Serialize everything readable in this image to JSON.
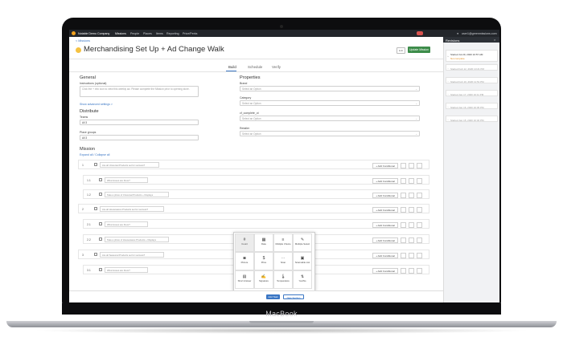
{
  "device": {
    "brand": "MacBook"
  },
  "topbar": {
    "company": "Notable Demo Company",
    "nav": [
      "Missions",
      "People",
      "Places",
      "Items",
      "Reporting",
      "Price/Perks"
    ],
    "user": "user1@greenmissions.com"
  },
  "header": {
    "back_link": "< Missions",
    "title": "Merchandising Set Up + Ad Change Walk",
    "small_button": "Edit",
    "primary_button": "Update Mission"
  },
  "tabs": [
    "Build",
    "Schedule",
    "Verify"
  ],
  "general": {
    "heading": "General",
    "instructions_label": "Instructions (optional)",
    "instructions_value": "Click the + info icon to view this weekly ad. Please complete the Mission prior to opening store.",
    "advanced_link": "Show advanced settings >"
  },
  "distribute": {
    "heading": "Distribute",
    "teams_label": "Teams",
    "teams_value": "All 3",
    "places_label": "Place groups",
    "places_value": "All 3"
  },
  "properties": {
    "heading": "Properties",
    "fields": [
      {
        "label": "Brand",
        "placeholder": "Select an Option"
      },
      {
        "label": "Category",
        "placeholder": "Select an Option"
      },
      {
        "label": "cf_complete_ct",
        "placeholder": "Select an Option"
      },
      {
        "label": "Retailer",
        "placeholder": "Select an Option"
      }
    ]
  },
  "mission": {
    "heading": "Mission",
    "expand_link": "Expand all / Collapse all",
    "rows": [
      {
        "num": "1",
        "question": "Are all Universal Products set for success?",
        "action": "+ Add Conditional"
      },
      {
        "num": "1.1",
        "question": "What issues are there?",
        "action": "+ Add Conditional"
      },
      {
        "num": "1.2",
        "question": "Take a photo of Universal Products + Displays",
        "action": "+ Add Conditional"
      },
      {
        "num": "2",
        "question": "Are all Housewares Products set for success?",
        "action": "+ Add Conditional"
      },
      {
        "num": "2.1",
        "question": "What issues are there?",
        "action": "+ Add Conditional"
      },
      {
        "num": "2.2",
        "question": "Take a photo of Housewares Products + Displays",
        "action": "+ Add Conditional"
      },
      {
        "num": "3",
        "question": "Are all Seasonal Products set for success?",
        "action": "+ Add Conditional"
      },
      {
        "num": "3.1",
        "question": "What issues are there?",
        "action": "+ Add Conditional"
      }
    ]
  },
  "question_types": [
    {
      "glyph": "#",
      "label": "Count"
    },
    {
      "glyph": "▦",
      "label": "Date"
    },
    {
      "glyph": "≡",
      "label": "Multiple Choice"
    },
    {
      "glyph": "✎",
      "label": "Multiple Select"
    },
    {
      "glyph": "◙",
      "label": "Picture"
    },
    {
      "glyph": "$",
      "label": "Price"
    },
    {
      "glyph": "⋯",
      "label": "Scan"
    },
    {
      "glyph": "▣",
      "label": "Scannable List"
    },
    {
      "glyph": "▤",
      "label": "Short Answer"
    },
    {
      "glyph": "✍",
      "label": "Signature"
    },
    {
      "glyph": "🌡",
      "label": "Temperature"
    },
    {
      "glyph": "⇅",
      "label": "Yes/No"
    }
  ],
  "bottom": {
    "add_task": "Add Task",
    "new_section": "New Section",
    "unsaved": "Unsaved changes",
    "save": "Save"
  },
  "revisions": {
    "title": "Revisions",
    "items": [
      {
        "date": "Started Jul 29, 2020 10:57 AM",
        "note": "Not complete"
      },
      {
        "date": "Started Feb 12, 2020 10:21 PM",
        "note": ""
      },
      {
        "date": "Started Feb 10, 2020 11:51 PM",
        "note": ""
      },
      {
        "date": "Started Jan 17, 2020 10:11 PM",
        "note": ""
      },
      {
        "date": "Started Jan 16, 2020 10:45 PM",
        "note": ""
      },
      {
        "date": "Started Jan 15, 2020 10:32 PM",
        "note": ""
      }
    ]
  },
  "colors": {
    "primary": "#3d8c4a",
    "link": "#3a76c4",
    "topbar": "#23262b"
  }
}
